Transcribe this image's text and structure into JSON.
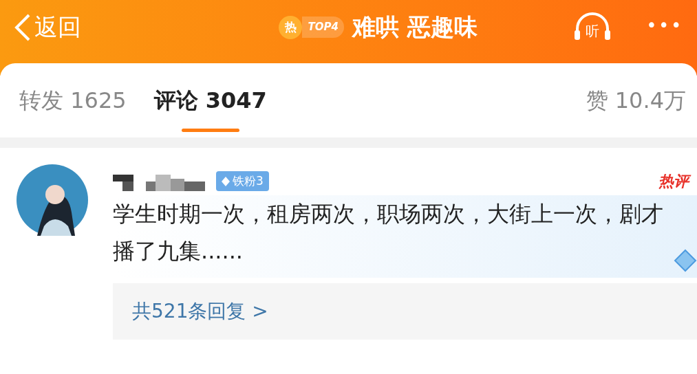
{
  "header": {
    "back_label": "返回",
    "hot_badge": "热",
    "rank_badge": "TOP4",
    "title": "难哄 恶趣味",
    "listen_label": "听",
    "more": "•••"
  },
  "tabs": [
    {
      "label": "转发 1625",
      "selected": false
    },
    {
      "label": "评论 3047",
      "selected": true
    }
  ],
  "likes": "赞 10.4万",
  "comment": {
    "fan_badge": "铁粉3",
    "hot_tag": "热评",
    "text": "学生时期一次，租房两次，职场两次，大街上一次，剧才播了九集......",
    "replies_link": "共521条回复 >"
  }
}
